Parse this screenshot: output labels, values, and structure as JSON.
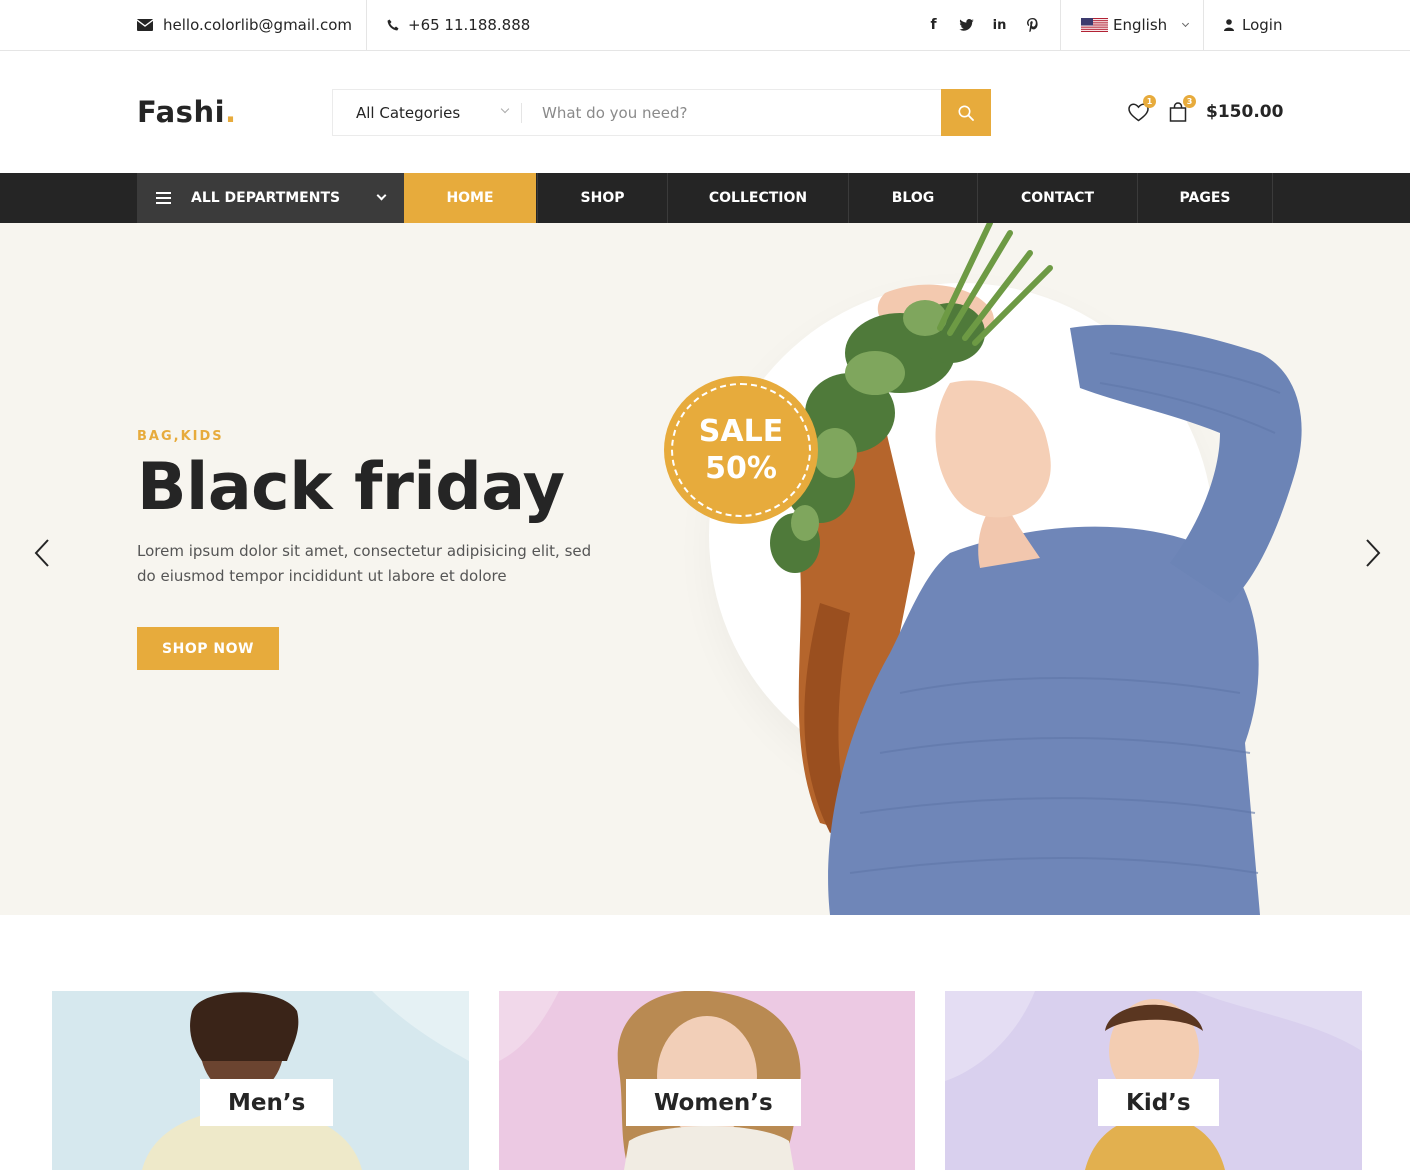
{
  "topbar": {
    "email": "hello.colorlib@gmail.com",
    "phone": "+65 11.188.888",
    "social": [
      "facebook-icon",
      "twitter-icon",
      "linkedin-icon",
      "pinterest-icon"
    ],
    "language": "English",
    "login": "Login"
  },
  "header": {
    "logo_text": "Fashi",
    "logo_dot": ".",
    "category_select": "All Categories",
    "search_placeholder": "What do you need?",
    "wishlist_count": "1",
    "cart_count": "3",
    "cart_total": "$150.00"
  },
  "nav": {
    "departments": "ALL DEPARTMENTS",
    "items": [
      "HOME",
      "SHOP",
      "COLLECTION",
      "BLOG",
      "CONTACT",
      "PAGES"
    ],
    "active": "HOME"
  },
  "hero": {
    "tag": "BAG,KIDS",
    "title": "Black friday",
    "description": "Lorem ipsum dolor sit amet, consectetur adipisicing elit, sed do eiusmod tempor incididunt ut labore et dolore",
    "button": "SHOP NOW",
    "sale_line1": "SALE",
    "sale_line2": "50%"
  },
  "categories": [
    "Men’s",
    "Women’s",
    "Kid’s"
  ],
  "colors": {
    "accent": "#e7ab3c",
    "dark": "#252525",
    "hero_bg": "#f7f5ef",
    "men_bg": "#d6e8ee",
    "women_bg": "#ecc9e3",
    "kids_bg": "#d9d0ee"
  }
}
